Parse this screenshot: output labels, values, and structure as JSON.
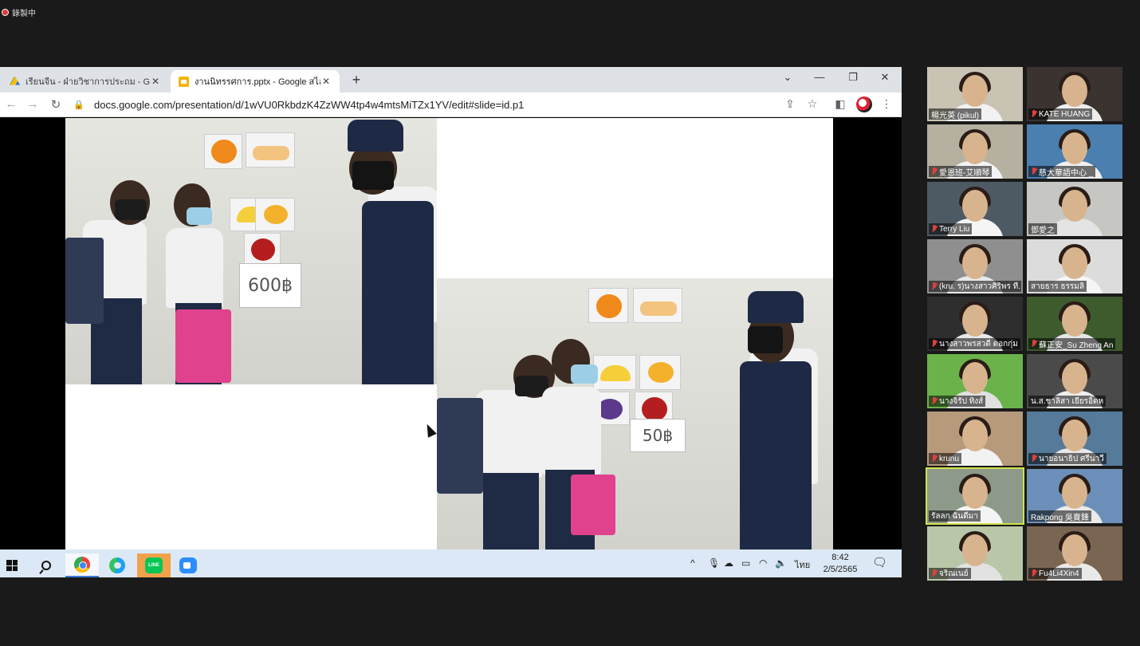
{
  "recording": {
    "label": "錄製中",
    "color": "#e03a3a"
  },
  "browser": {
    "tabs": [
      {
        "label": "เรียนจีน - ฝ่ายวิชาการประถม - Googl",
        "icon": "google-drive-icon",
        "active": false
      },
      {
        "label": "งานนิทรรศการ.pptx - Google สไลด์",
        "icon": "google-slides-icon",
        "active": true
      }
    ],
    "url": "docs.google.com/presentation/d/1wVU0RkbdzK4ZzWW4tp4w4mtsMiTZx1YV/edit#slide=id.p1"
  },
  "slide": {
    "photo1_sign": "600฿",
    "photo2_sign": "50฿"
  },
  "taskbar": {
    "language": "ไทย",
    "time": "8:42",
    "date": "2/5/2565",
    "accent": "#3b78d8"
  },
  "participants": [
    {
      "name": "楊光英 (pikul)",
      "muted": false,
      "bg": "#c9c3b4",
      "shirt": "#f2f2f2"
    },
    {
      "name": "KATE HUANG",
      "muted": true,
      "bg": "#3a3330",
      "shirt": "#eeeeee"
    },
    {
      "name": "愛恩班-艾順琴",
      "muted": true,
      "bg": "#b5b09f",
      "shirt": "#f3f3f3"
    },
    {
      "name": "慈大華語中心 _",
      "muted": true,
      "bg": "#4a7fb0",
      "shirt": "#f0f0f0"
    },
    {
      "name": "Terry Liu",
      "muted": true,
      "bg": "#4d5a63",
      "shirt": "#f5f5f5"
    },
    {
      "name": "鄧愛之",
      "muted": false,
      "bg": "#c6c7c2",
      "shirt": "#e4e4e4"
    },
    {
      "name": "(kru. ร)นางสาวศิริพร ที...",
      "muted": true,
      "bg": "#8f8f8f",
      "shirt": "#e9e9e9"
    },
    {
      "name": "สายธาร ธรรมลิ",
      "muted": false,
      "bg": "#dcdcdc",
      "shirt": "#f5f5f5"
    },
    {
      "name": "นางสาวพรสวดี ดอกกุ่ม",
      "muted": true,
      "bg": "#2e2e2e",
      "shirt": "#e8e8e8"
    },
    {
      "name": "蘇正安_Su Zheng An",
      "muted": true,
      "bg": "#3e5b2e",
      "shirt": "#e6e6e6"
    },
    {
      "name": "นางจิรัป ทิงส์",
      "muted": true,
      "bg": "#6ab34a",
      "shirt": "#e0e0e0"
    },
    {
      "name": "น.ส.ชาลิสา เยียรอิ๊ดห",
      "muted": false,
      "bg": "#4a4a4a",
      "shirt": "#eeeeee"
    },
    {
      "name": "krunu",
      "muted": true,
      "bg": "#b79a7c",
      "shirt": "#f2f2f2"
    },
    {
      "name": "นายอนาธิป ศรีนาวี",
      "muted": true,
      "bg": "#567a9a",
      "shirt": "#e8e8e8"
    },
    {
      "name": "รัลลก ฉันดีมา",
      "muted": false,
      "bg": "#8d9a8a",
      "shirt": "#f4f4f4"
    },
    {
      "name": "Rakpong 吳賣鋒",
      "muted": false,
      "bg": "#6b8fb8",
      "shirt": "#eaeaea"
    },
    {
      "name": "จริณเนย์",
      "muted": true,
      "bg": "#b9c7a8",
      "shirt": "#e2e2e2"
    },
    {
      "name": "Fu4Li4Xin4",
      "muted": true,
      "bg": "#7a6452",
      "shirt": "#e9e9e9"
    }
  ]
}
